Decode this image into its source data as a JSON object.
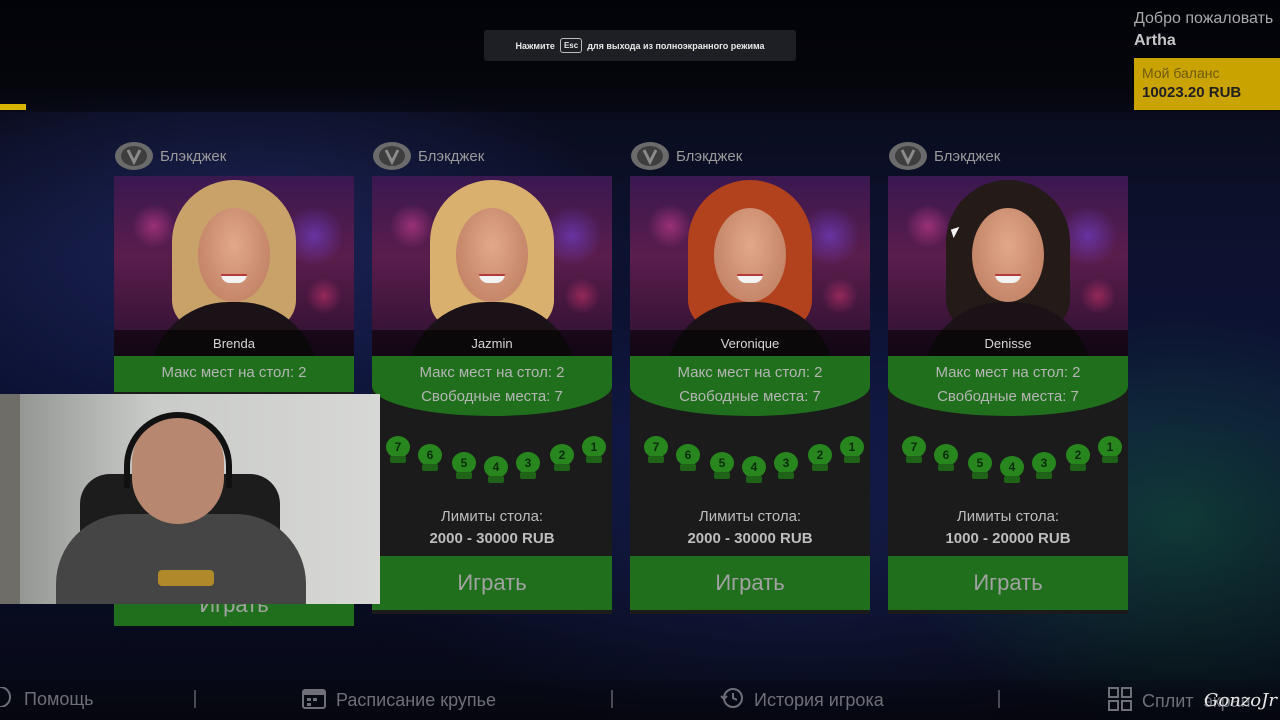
{
  "fullscreen_notice": {
    "prefix": "Нажмите",
    "key": "Esc",
    "suffix": "для выхода из полноэкранного режима"
  },
  "header": {
    "welcome": "Добро пожаловать",
    "username": "Artha",
    "balance_label": "Мой баланс",
    "balance_value": "10023.20 RUB"
  },
  "colors": {
    "accent_yellow": "#c9a300",
    "table_green": "#1f6f1c",
    "seat_green": "#28861f"
  },
  "tables": [
    {
      "game": "Блэкджек",
      "logo_icon": "blackjack-logo-icon",
      "dealer": "Brenda",
      "hair_color": "#c9a26a",
      "max_seats": "Макс мест на стол: 2",
      "free_seats": "",
      "seat_numbers": [],
      "limits_label": "",
      "limits_value": "",
      "play_label": "Играть"
    },
    {
      "game": "Блэкджек",
      "logo_icon": "blackjack-logo-icon",
      "dealer": "Jazmin",
      "hair_color": "#d9b06e",
      "max_seats": "Макс мест на стол: 2",
      "free_seats": "Свободные места: 7",
      "seat_numbers": [
        "7",
        "6",
        "5",
        "4",
        "3",
        "2",
        "1"
      ],
      "limits_label": "Лимиты стола:",
      "limits_value": "2000 - 30000 RUB",
      "play_label": "Играть"
    },
    {
      "game": "Блэкджек",
      "logo_icon": "blackjack-logo-icon",
      "dealer": "Veronique",
      "hair_color": "#b2421e",
      "max_seats": "Макс мест на стол: 2",
      "free_seats": "Свободные места: 7",
      "seat_numbers": [
        "7",
        "6",
        "5",
        "4",
        "3",
        "2",
        "1"
      ],
      "limits_label": "Лимиты стола:",
      "limits_value": "2000 - 30000 RUB",
      "play_label": "Играть"
    },
    {
      "game": "Блэкджек",
      "logo_icon": "blackjack-logo-icon",
      "dealer": "Denisse",
      "hair_color": "#241a18",
      "max_seats": "Макс мест на стол: 2",
      "free_seats": "Свободные места: 7",
      "seat_numbers": [
        "7",
        "6",
        "5",
        "4",
        "3",
        "2",
        "1"
      ],
      "limits_label": "Лимиты стола:",
      "limits_value": "1000 - 20000 RUB",
      "play_label": "Играть"
    }
  ],
  "bottom_bar": {
    "help": "Помощь",
    "schedule": "Расписание крупье",
    "history": "История игрока",
    "split": "Сплит",
    "split_suffix": "экран",
    "help_icon": "help-circle-icon",
    "schedule_icon": "calendar-icon",
    "history_icon": "history-icon",
    "split_icon": "grid-icon"
  },
  "watermark": "GonzoJr"
}
